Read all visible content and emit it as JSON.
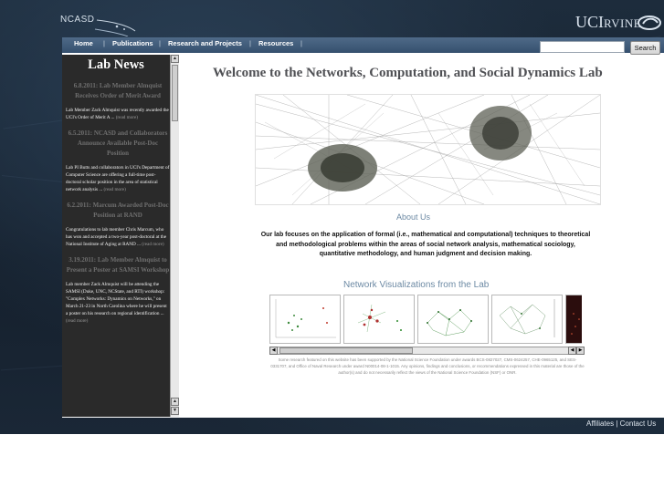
{
  "header": {
    "logo_text": "NCASD",
    "university_logo": {
      "main": "UCI",
      "secondary": "RVINE"
    }
  },
  "nav": {
    "items": [
      {
        "label": "Home"
      },
      {
        "label": "Publications"
      },
      {
        "label": "Research and Projects"
      },
      {
        "label": "Resources"
      }
    ],
    "separator": "|"
  },
  "search": {
    "value": "",
    "button_label": "Search"
  },
  "sidebar": {
    "title": "Lab News",
    "news": [
      {
        "headline": "6.8.2011: Lab Member Almquist Receives Order of Merit Award",
        "text": "Lab Member Zack Almquist was recently awarded the UCI's Order of Merit A ...",
        "more": "(read more)"
      },
      {
        "headline": "6.5.2011: NCASD and Collaborators Announce Available Post-Doc Position",
        "text": "Lab PI Butts and collaborators in UCI's Department of Computer Science are offering a full-time post-doctoral scholar position in the area of statistical network analysis ...",
        "more": "(read more)"
      },
      {
        "headline": "6.2.2011: Marcum Awarded Post-Doc Position at RAND",
        "text": "Congratulations to lab member Chris Marcum, who has won and accepted a two-year post-doctoral at the National Institute of Aging at RAND ...",
        "more": "(read more)"
      },
      {
        "headline": "3.19.2011: Lab Member Almquist to Present a Poster at SAMSI Workshop",
        "text": "Lab member Zack Almquist will be attending the SAMSI (Duke, UNC, NCState, and RTI) workshop: \"Complex Networks: Dynamics on Networks,\" on March 21-23 in North Carolina where he will present a poster on his research on regional identification ...",
        "more": "(read more)"
      }
    ]
  },
  "main": {
    "title": "Welcome to the Networks, Computation, and Social Dynamics Lab",
    "about_heading": "About Us",
    "about_text": "Our lab focuses on the application of formal (i.e., mathematical and computational) techniques to theoretical and methodological problems within the areas of social network analysis, mathematical sociology, quantitative methodology, and human judgment and decision making.",
    "viz_heading": "Network Visualizations from the Lab",
    "footnote": "Some research featured on this website has been supported by the National Science Foundation under awards BCS-0827027, CMS-0624257, CHE-0965125, and SES-0331707, and Office of Naval Research under award N00014-08-1-1015. Any opinions, findings and conclusions, or recommendations expressed in this material are those of the author(s) and do not necessarily reflect the views of the National Science Foundation (NSF) or ONR."
  },
  "footer": {
    "affiliates": "Affiliates",
    "separator": "|",
    "contact": "Contact Us"
  },
  "colors": {
    "background_dark": "#1a2736",
    "nav_blue": "#3f5a78",
    "sidebar_dark": "#2a2a2a",
    "heading_blue": "#6d8aa4",
    "title_gray": "#4f5054"
  }
}
